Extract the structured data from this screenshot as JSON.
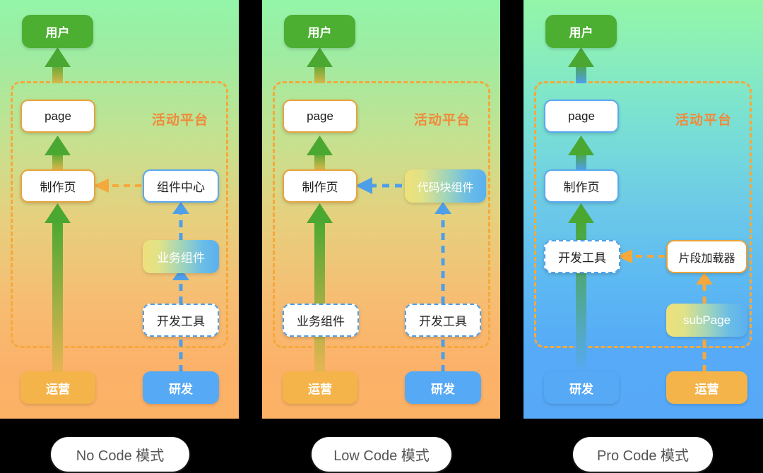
{
  "panels": [
    {
      "id": "no-code",
      "caption": "No Code 模式",
      "region_label": "活动平台",
      "nodes": {
        "user": "用户",
        "page": "page",
        "build_page": "制作页",
        "component_center": "组件中心",
        "business_component": "业务组件",
        "dev_tool": "开发工具",
        "role_left": "运营",
        "role_right": "研发"
      }
    },
    {
      "id": "low-code",
      "caption": "Low Code 模式",
      "region_label": "活动平台",
      "nodes": {
        "user": "用户",
        "page": "page",
        "build_page": "制作页",
        "code_block_component": "代码块组件",
        "business_component": "业务组件",
        "dev_tool": "开发工具",
        "role_left": "运营",
        "role_right": "研发"
      }
    },
    {
      "id": "pro-code",
      "caption": "Pro Code 模式",
      "region_label": "活动平台",
      "nodes": {
        "user": "用户",
        "page": "page",
        "build_page": "制作页",
        "dev_tool": "开发工具",
        "fragment_loader": "片段加载器",
        "sub_page": "subPage",
        "role_left": "研发",
        "role_right": "运营"
      }
    }
  ],
  "colors": {
    "user_green": "#4caf32",
    "region_orange": "#f5a83c",
    "region_label_orange": "#f08a3c",
    "ops_orange": "#f4b44a",
    "dev_blue": "#56a9f5",
    "arrow_green": "#4caf32",
    "arrow_blue": "#4f9fe8",
    "arrow_orange": "#f5a83c"
  }
}
